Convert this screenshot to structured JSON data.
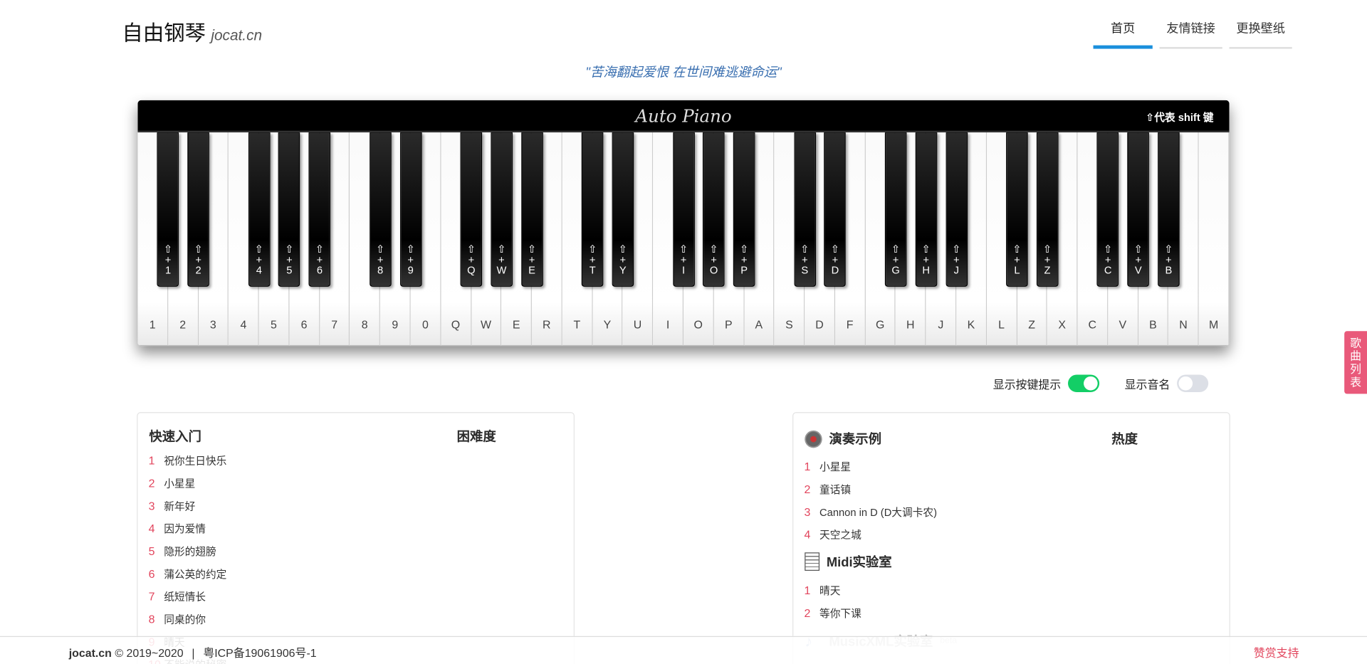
{
  "header": {
    "brand_zh": "自由钢琴",
    "brand_en": "jocat.cn",
    "nav": [
      {
        "label": "首页",
        "active": true
      },
      {
        "label": "友情链接",
        "active": false
      },
      {
        "label": "更换壁纸",
        "active": false
      }
    ],
    "quote": "\"苦海翻起爱恨 在世间难逃避命运\""
  },
  "piano": {
    "logo": "Auto Piano",
    "shift_hint": "⇧代表 shift 键",
    "white_keys": [
      "1",
      "2",
      "3",
      "4",
      "5",
      "6",
      "7",
      "8",
      "9",
      "0",
      "Q",
      "W",
      "E",
      "R",
      "T",
      "Y",
      "U",
      "I",
      "O",
      "P",
      "A",
      "S",
      "D",
      "F",
      "G",
      "H",
      "J",
      "K",
      "L",
      "Z",
      "X",
      "C",
      "V",
      "B",
      "N",
      "M"
    ],
    "black_keys": [
      "1",
      "2",
      "4",
      "5",
      "6",
      "8",
      "9",
      "Q",
      "W",
      "E",
      "T",
      "Y",
      "I",
      "O",
      "P",
      "S",
      "D",
      "G",
      "H",
      "J",
      "L",
      "Z",
      "C",
      "V",
      "B"
    ]
  },
  "toggles": {
    "show_key_hint": {
      "label": "显示按键提示",
      "on": true
    },
    "show_note_name": {
      "label": "显示音名",
      "on": false
    }
  },
  "left_card": {
    "title": "快速入门",
    "difficulty_label": "困难度",
    "songs": [
      "祝你生日快乐",
      "小星星",
      "新年好",
      "因为爱情",
      "隐形的翅膀",
      "蒲公英的约定",
      "纸短情长",
      "同桌的你",
      "晴天",
      "不能说的秘密"
    ]
  },
  "right_card": {
    "title": "演奏示例",
    "heat_label": "热度",
    "songs": [
      "小星星",
      "童话镇",
      "Cannon in D (D大调卡农)",
      "天空之城"
    ],
    "midi_title": "Midi实验室",
    "midi_songs": [
      "晴天",
      "等你下课"
    ],
    "xml_title": "MusicXML实验室",
    "xml_badge": "beta"
  },
  "side_tab": "歌曲列表",
  "footer": {
    "site": "jocat.cn",
    "copyright": "© 2019~2020",
    "sep": "|",
    "icp": "粤ICP备19061906号-1",
    "support": "赞赏支持"
  },
  "colors": {
    "accent": "#1a8fdc",
    "song_index": "#e2445c",
    "toggle_on": "#13ce66",
    "side_tab": "#e9597a"
  }
}
